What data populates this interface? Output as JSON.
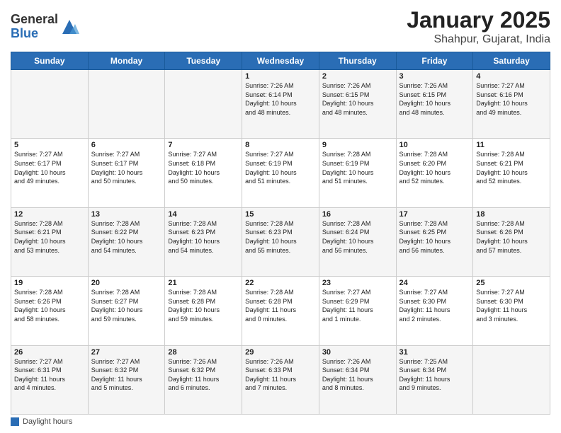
{
  "logo": {
    "general": "General",
    "blue": "Blue"
  },
  "title": "January 2025",
  "subtitle": "Shahpur, Gujarat, India",
  "days_of_week": [
    "Sunday",
    "Monday",
    "Tuesday",
    "Wednesday",
    "Thursday",
    "Friday",
    "Saturday"
  ],
  "footer_label": "Daylight hours",
  "weeks": [
    [
      {
        "day": "",
        "info": ""
      },
      {
        "day": "",
        "info": ""
      },
      {
        "day": "",
        "info": ""
      },
      {
        "day": "1",
        "info": "Sunrise: 7:26 AM\nSunset: 6:14 PM\nDaylight: 10 hours\nand 48 minutes."
      },
      {
        "day": "2",
        "info": "Sunrise: 7:26 AM\nSunset: 6:15 PM\nDaylight: 10 hours\nand 48 minutes."
      },
      {
        "day": "3",
        "info": "Sunrise: 7:26 AM\nSunset: 6:15 PM\nDaylight: 10 hours\nand 48 minutes."
      },
      {
        "day": "4",
        "info": "Sunrise: 7:27 AM\nSunset: 6:16 PM\nDaylight: 10 hours\nand 49 minutes."
      }
    ],
    [
      {
        "day": "5",
        "info": "Sunrise: 7:27 AM\nSunset: 6:17 PM\nDaylight: 10 hours\nand 49 minutes."
      },
      {
        "day": "6",
        "info": "Sunrise: 7:27 AM\nSunset: 6:17 PM\nDaylight: 10 hours\nand 50 minutes."
      },
      {
        "day": "7",
        "info": "Sunrise: 7:27 AM\nSunset: 6:18 PM\nDaylight: 10 hours\nand 50 minutes."
      },
      {
        "day": "8",
        "info": "Sunrise: 7:27 AM\nSunset: 6:19 PM\nDaylight: 10 hours\nand 51 minutes."
      },
      {
        "day": "9",
        "info": "Sunrise: 7:28 AM\nSunset: 6:19 PM\nDaylight: 10 hours\nand 51 minutes."
      },
      {
        "day": "10",
        "info": "Sunrise: 7:28 AM\nSunset: 6:20 PM\nDaylight: 10 hours\nand 52 minutes."
      },
      {
        "day": "11",
        "info": "Sunrise: 7:28 AM\nSunset: 6:21 PM\nDaylight: 10 hours\nand 52 minutes."
      }
    ],
    [
      {
        "day": "12",
        "info": "Sunrise: 7:28 AM\nSunset: 6:21 PM\nDaylight: 10 hours\nand 53 minutes."
      },
      {
        "day": "13",
        "info": "Sunrise: 7:28 AM\nSunset: 6:22 PM\nDaylight: 10 hours\nand 54 minutes."
      },
      {
        "day": "14",
        "info": "Sunrise: 7:28 AM\nSunset: 6:23 PM\nDaylight: 10 hours\nand 54 minutes."
      },
      {
        "day": "15",
        "info": "Sunrise: 7:28 AM\nSunset: 6:23 PM\nDaylight: 10 hours\nand 55 minutes."
      },
      {
        "day": "16",
        "info": "Sunrise: 7:28 AM\nSunset: 6:24 PM\nDaylight: 10 hours\nand 56 minutes."
      },
      {
        "day": "17",
        "info": "Sunrise: 7:28 AM\nSunset: 6:25 PM\nDaylight: 10 hours\nand 56 minutes."
      },
      {
        "day": "18",
        "info": "Sunrise: 7:28 AM\nSunset: 6:26 PM\nDaylight: 10 hours\nand 57 minutes."
      }
    ],
    [
      {
        "day": "19",
        "info": "Sunrise: 7:28 AM\nSunset: 6:26 PM\nDaylight: 10 hours\nand 58 minutes."
      },
      {
        "day": "20",
        "info": "Sunrise: 7:28 AM\nSunset: 6:27 PM\nDaylight: 10 hours\nand 59 minutes."
      },
      {
        "day": "21",
        "info": "Sunrise: 7:28 AM\nSunset: 6:28 PM\nDaylight: 10 hours\nand 59 minutes."
      },
      {
        "day": "22",
        "info": "Sunrise: 7:28 AM\nSunset: 6:28 PM\nDaylight: 11 hours\nand 0 minutes."
      },
      {
        "day": "23",
        "info": "Sunrise: 7:27 AM\nSunset: 6:29 PM\nDaylight: 11 hours\nand 1 minute."
      },
      {
        "day": "24",
        "info": "Sunrise: 7:27 AM\nSunset: 6:30 PM\nDaylight: 11 hours\nand 2 minutes."
      },
      {
        "day": "25",
        "info": "Sunrise: 7:27 AM\nSunset: 6:30 PM\nDaylight: 11 hours\nand 3 minutes."
      }
    ],
    [
      {
        "day": "26",
        "info": "Sunrise: 7:27 AM\nSunset: 6:31 PM\nDaylight: 11 hours\nand 4 minutes."
      },
      {
        "day": "27",
        "info": "Sunrise: 7:27 AM\nSunset: 6:32 PM\nDaylight: 11 hours\nand 5 minutes."
      },
      {
        "day": "28",
        "info": "Sunrise: 7:26 AM\nSunset: 6:32 PM\nDaylight: 11 hours\nand 6 minutes."
      },
      {
        "day": "29",
        "info": "Sunrise: 7:26 AM\nSunset: 6:33 PM\nDaylight: 11 hours\nand 7 minutes."
      },
      {
        "day": "30",
        "info": "Sunrise: 7:26 AM\nSunset: 6:34 PM\nDaylight: 11 hours\nand 8 minutes."
      },
      {
        "day": "31",
        "info": "Sunrise: 7:25 AM\nSunset: 6:34 PM\nDaylight: 11 hours\nand 9 minutes."
      },
      {
        "day": "",
        "info": ""
      }
    ]
  ]
}
